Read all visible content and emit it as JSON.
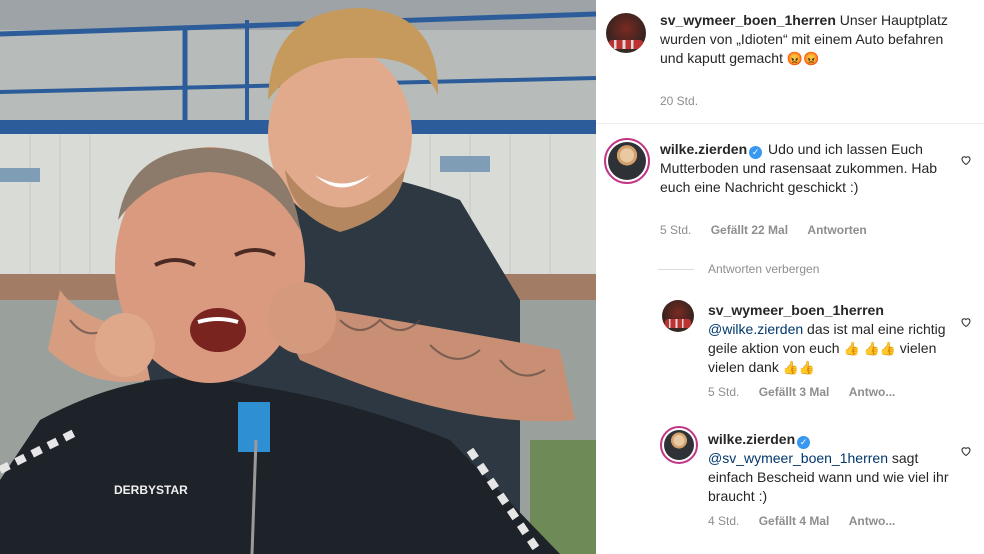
{
  "post": {
    "image_alt_icon": "photo"
  },
  "caption": {
    "username": "sv_wymeer_boen_1herren",
    "text": "Unser Hauptplatz wurden von „Idioten“ mit einem Auto befahren und kaputt gemacht",
    "emojis": "😡😡",
    "time": "20 Std."
  },
  "comments": [
    {
      "username": "wilke.zierden",
      "verified": true,
      "text": "Udo und ich lassen Euch Mutterboden und rasensaat zukommen. Hab euch eine Nachricht geschickt :)",
      "time": "5 Std.",
      "likes": "Gefällt 22 Mal",
      "reply": "Antworten"
    }
  ],
  "hide_replies_label": "Antworten verbergen",
  "replies": [
    {
      "username": "sv_wymeer_boen_1herren",
      "mention": "@wilke.zierden",
      "text_part1": "das ist mal eine richtig geile aktion von euch",
      "emoji_part1": "👍",
      "emoji_part2": "👍👍",
      "text_part2": "vielen vielen dank",
      "emoji_part3": "👍👍",
      "time": "5 Std.",
      "likes": "Gefällt 3 Mal",
      "reply": "Antwo..."
    },
    {
      "username": "wilke.zierden",
      "verified": true,
      "mention": "@sv_wymeer_boen_1herren",
      "text": "sagt einfach Bescheid wann und wie viel ihr braucht :)",
      "time": "4 Std.",
      "likes": "Gefällt 4 Mal",
      "reply": "Antwo..."
    }
  ],
  "icons": {
    "like": "heart-outline-icon",
    "verified": "verified-badge-icon"
  },
  "colors": {
    "verified_blue": "#3897f0",
    "mention_blue": "#00376b",
    "meta_gray": "#8e8e8e",
    "story_ring": "#c13584"
  },
  "photo_text": {
    "jacket_brand": "DERBYSTAR"
  }
}
